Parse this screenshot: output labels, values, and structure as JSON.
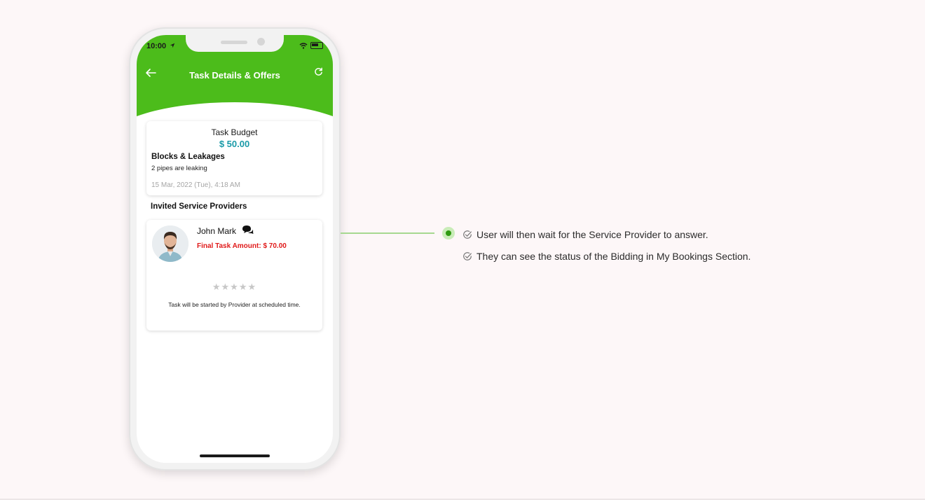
{
  "status_bar": {
    "time": "10:00"
  },
  "header": {
    "title": "Task Details & Offers"
  },
  "budget_card": {
    "label": "Task Budget",
    "amount": "$ 50.00",
    "task_title": "Blocks & Leakages",
    "description": "2 pipes are leaking",
    "date": "15 Mar, 2022 (Tue),  4:18 AM"
  },
  "providers_section": {
    "title": "Invited Service Providers"
  },
  "provider": {
    "name": "John Mark",
    "final_amount": "Final Task Amount: $ 70.00",
    "rating": 0,
    "rating_max": 5,
    "note": "Task will be started by Provider at scheduled time."
  },
  "notes": [
    {
      "text": "User will then wait for the Service Provider to answer."
    },
    {
      "text": "They can see the status of the Bidding in My Bookings Section."
    }
  ],
  "colors": {
    "brand_green": "#4cbc1b",
    "budget_teal": "#1a9aa8",
    "amount_red": "#e01a1a",
    "page_background": "#fdf7f8"
  },
  "icons": [
    "back-arrow-icon",
    "refresh-icon",
    "chat-icon",
    "star-icon",
    "check-circle-icon",
    "wifi-icon",
    "battery-icon",
    "location-arrow-icon"
  ]
}
